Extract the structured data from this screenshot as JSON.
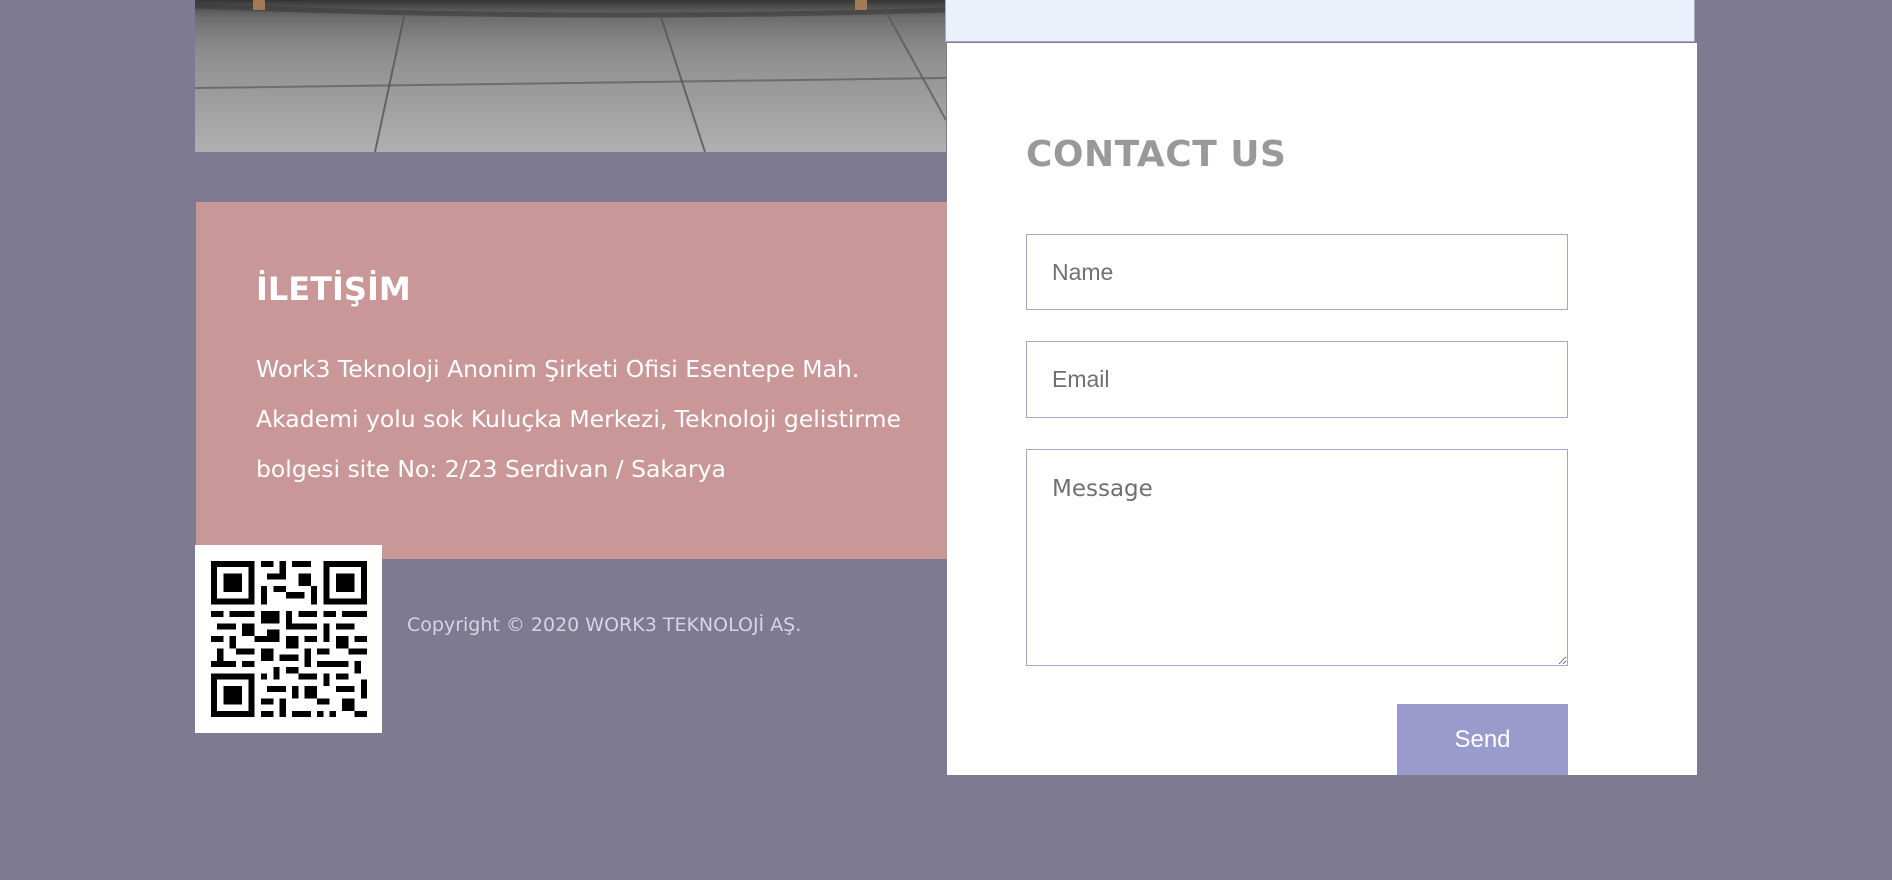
{
  "info": {
    "title": "İLETİŞİM",
    "address": "Work3 Teknoloji Anonim Şirketi Ofisi Esentepe Mah. Akademi yolu sok Kuluçka Merkezi, Teknoloji gelistirme bolgesi site No: 2/23 Serdivan / Sakarya"
  },
  "contact": {
    "title": "CONTACT US",
    "name_placeholder": "Name",
    "email_placeholder": "Email",
    "message_placeholder": "Message",
    "send_label": "Send"
  },
  "footer": {
    "copyright": "Copyright © 2020 WORK3 TEKNOLOJİ AŞ."
  },
  "colors": {
    "page_background": "#7e7a91",
    "info_panel": "#c99797",
    "send_button": "#9b9acd",
    "field_border": "#a6a6c8",
    "title_grey": "#9a9898"
  },
  "icons": {
    "qr": "qr-code-icon"
  }
}
